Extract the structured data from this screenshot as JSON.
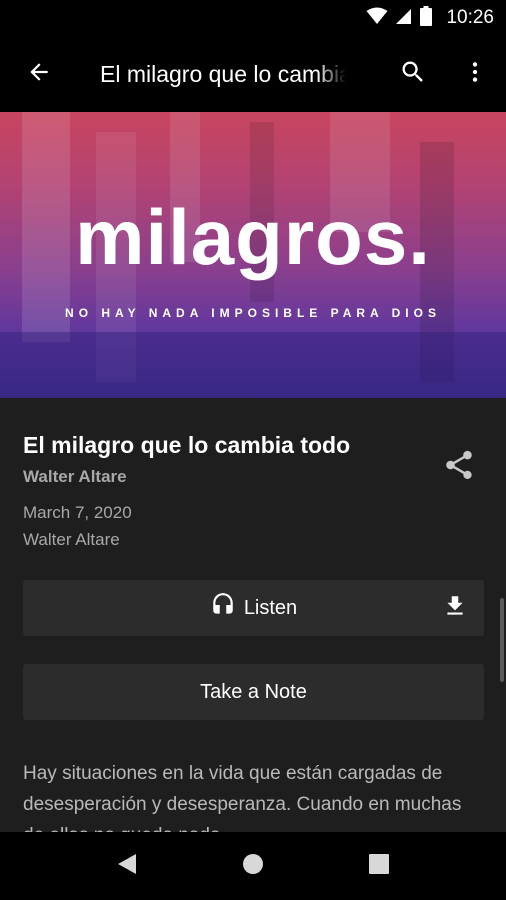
{
  "status_bar": {
    "time": "10:26",
    "icons": [
      "wifi-icon",
      "signal-icon",
      "battery-icon"
    ]
  },
  "app_bar": {
    "title": "El milagro que lo cambia todo",
    "back_icon": "arrow-back-icon",
    "search_icon": "search-icon",
    "menu_icon": "more-vert-icon"
  },
  "hero": {
    "title": "milagros.",
    "subtitle": "NO HAY NADA IMPOSIBLE PARA DIOS"
  },
  "sermon": {
    "title": "El milagro que lo cambia todo",
    "series_speaker": "Walter Altare",
    "date": "March 7, 2020",
    "speaker": "Walter Altare",
    "share_icon": "share-icon"
  },
  "actions": {
    "listen_label": "Listen",
    "listen_icon": "headphones-icon",
    "download_icon": "download-icon",
    "note_label": "Take a Note"
  },
  "description": "Hay situaciones en la vida que están cargadas de desesperación y desesperanza. Cuando en muchas de ellas no queda nada",
  "nav_bar": {
    "icons": [
      "back-triangle-icon",
      "home-circle-icon",
      "recents-square-icon"
    ]
  }
}
